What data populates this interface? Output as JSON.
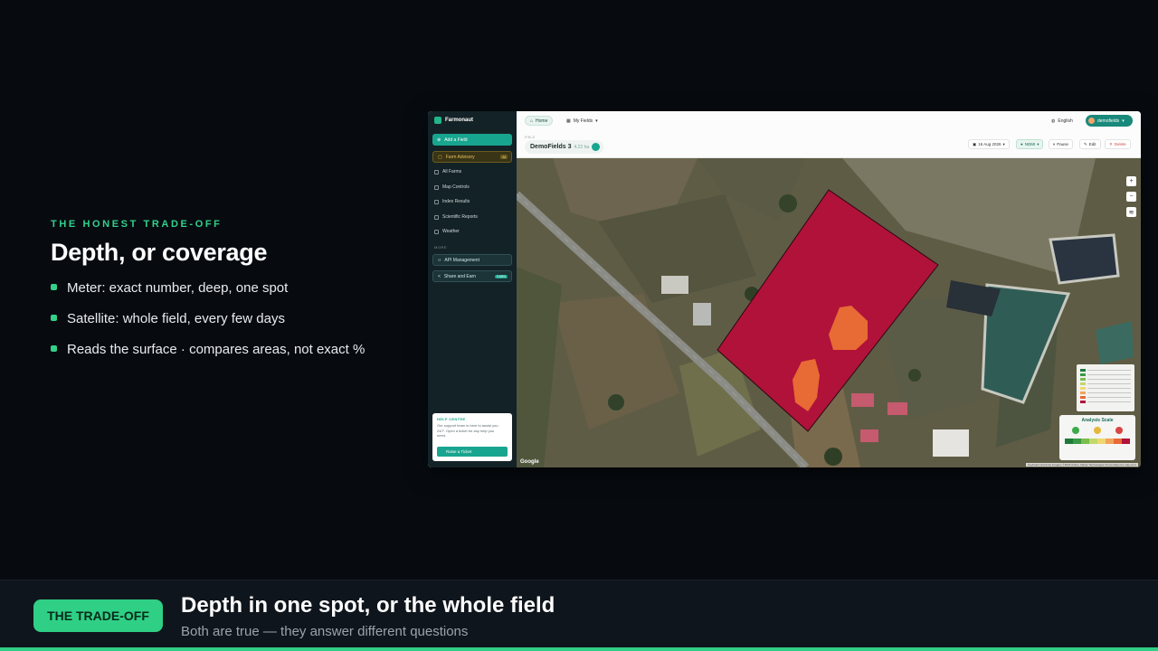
{
  "slide": {
    "eyebrow": "THE HONEST TRADE-OFF",
    "headline": "Depth, or coverage",
    "bullets": [
      "Meter: exact number, deep, one spot",
      "Satellite: whole field, every few days",
      "Reads the surface · compares areas, not exact %"
    ]
  },
  "app": {
    "brand": "Farmonaut",
    "sidebar": {
      "add_field": "Add a Field",
      "farm_advisory": "Farm Advisory",
      "farm_advisory_tag": "AI",
      "items": [
        "All Farms",
        "Map Controls",
        "Index Results",
        "Scientific Reports",
        "Weather"
      ],
      "section_label": "MORE",
      "api_management": "API Management",
      "share_earn": "Share and Earn",
      "share_earn_tag": "EARN",
      "help": {
        "title": "HELP CENTRE",
        "text": "Our support team is here to assist you 24/7. Open a ticket for any help you need.",
        "button": "Raise a Ticket"
      }
    },
    "topbar": {
      "home": "Home",
      "my_fields": "My Fields",
      "language": "English",
      "user": "demofields"
    },
    "field": {
      "label": "FIELD",
      "name": "DemoFields 3",
      "area": "4.22 ha",
      "date": "16 Aug 2026",
      "index": "NDMI",
      "pause": "Pause",
      "edit": "Edit",
      "delete": "Delete"
    },
    "map": {
      "zoom_in": "+",
      "zoom_out": "−",
      "layers_icon": "layers-icon",
      "analysis_title": "Analysis Scale",
      "watermark": "Google",
      "attribution": "Keyboard shortcuts  Imagery ©2026 Airbus, Maxar Technologies  Terms  Report a map error"
    }
  },
  "caption": {
    "pill": "THE TRADE-OFF",
    "title": "Depth in one spot, or the whole field",
    "subtitle": "Both are true — they answer different questions"
  },
  "colors": {
    "accent": "#2fcf85",
    "field_overlay": "#b0123a",
    "hotspot": "#e86a34",
    "app_primary": "#18a58f"
  }
}
